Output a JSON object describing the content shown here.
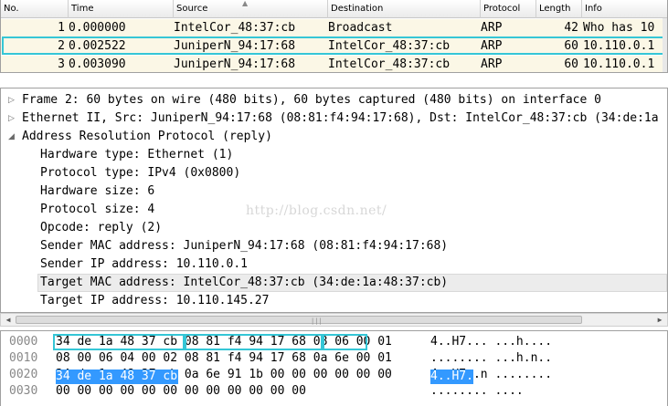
{
  "packet_list": {
    "columns": [
      "No.",
      "Time",
      "Source",
      "Destination",
      "Protocol",
      "Length",
      "Info"
    ],
    "rows": [
      {
        "no": "1",
        "time": "0.000000",
        "source": "IntelCor_48:37:cb",
        "destination": "Broadcast",
        "protocol": "ARP",
        "length": "42",
        "info": "Who has 10"
      },
      {
        "no": "2",
        "time": "0.002522",
        "source": "JuniperN_94:17:68",
        "destination": "IntelCor_48:37:cb",
        "protocol": "ARP",
        "length": "60",
        "info": "10.110.0.1"
      },
      {
        "no": "3",
        "time": "0.003090",
        "source": "JuniperN_94:17:68",
        "destination": "IntelCor_48:37:cb",
        "protocol": "ARP",
        "length": "60",
        "info": "10.110.0.1"
      }
    ]
  },
  "details": {
    "frame": "Frame 2: 60 bytes on wire (480 bits), 60 bytes captured (480 bits) on interface 0",
    "ethernet": "Ethernet II, Src: JuniperN_94:17:68 (08:81:f4:94:17:68), Dst: IntelCor_48:37:cb (34:de:1a",
    "arp": "Address Resolution Protocol (reply)",
    "fields": [
      "Hardware type: Ethernet (1)",
      "Protocol type: IPv4 (0x0800)",
      "Hardware size: 6",
      "Protocol size: 4",
      "Opcode: reply (2)",
      "Sender MAC address: JuniperN_94:17:68 (08:81:f4:94:17:68)",
      "Sender IP address: 10.110.0.1",
      "Target MAC address: IntelCor_48:37:cb (34:de:1a:48:37:cb)",
      "Target IP address: 10.110.145.27"
    ],
    "watermark": "http://blog.csdn.net/"
  },
  "bytes": {
    "rows": [
      {
        "offset": "0000",
        "hex": "34 de 1a 48 37 cb 08 81  f4 94 17 68 08 06 00 01",
        "ascii": "4..H7... ...h...."
      },
      {
        "offset": "0010",
        "hex": "08 00 06 04 00 02 08 81  f4 94 17 68 0a 6e 00 01",
        "ascii": "........ ...h.n.."
      },
      {
        "offset": "0020",
        "hex": "34 de 1a 48 37 cb 0a 6e  91 1b 00 00 00 00 00 00",
        "ascii": "4..H7..n ........"
      },
      {
        "offset": "0030",
        "hex": "00 00 00 00 00 00 00 00  00 00 00 00",
        "ascii": "........ ...."
      }
    ],
    "selected_hex": "34 de 1a 48 37 cb",
    "selected_ascii": "4..H7."
  },
  "colors": {
    "selection_outline": "#35c6d6",
    "byte_highlight": "#3399ff",
    "row_highlight": "#ececec"
  }
}
